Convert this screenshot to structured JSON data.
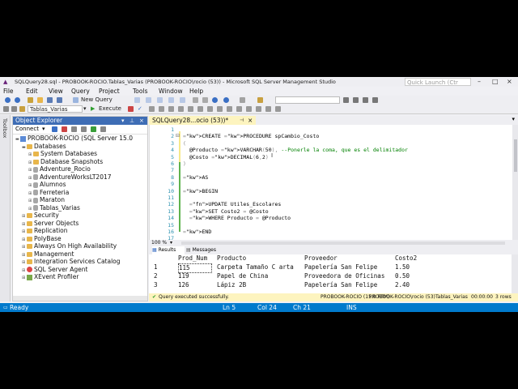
{
  "window": {
    "title": "SQLQuery28.sql - PROBOOK-ROCIO.Tablas_Varias (PROBOOK-ROCIO\\rocio (53)) - Microsoft SQL Server Management Studio",
    "quick_launch_placeholder": "Quick Launch (Ctr"
  },
  "menu": [
    "File",
    "Edit",
    "View",
    "Query",
    "Project",
    "Tools",
    "Window",
    "Help"
  ],
  "toolbar": {
    "new_query": "New Query",
    "database": "Tablas_Varias",
    "execute": "Execute"
  },
  "toolbox_label": "Toolbox",
  "object_explorer": {
    "title": "Object Explorer",
    "connect": "Connect",
    "tree": [
      {
        "label": "PROBOOK-ROCIO (SQL Server 15.0",
        "level": 0,
        "icon": "server",
        "exp": "−"
      },
      {
        "label": "Databases",
        "level": 1,
        "icon": "folder",
        "exp": "−"
      },
      {
        "label": "System Databases",
        "level": 2,
        "icon": "folder",
        "exp": "+"
      },
      {
        "label": "Database Snapshots",
        "level": 2,
        "icon": "folder",
        "exp": "+"
      },
      {
        "label": "Adventure_Rocio",
        "level": 2,
        "icon": "db",
        "exp": "+"
      },
      {
        "label": "AdventureWorksLT2017",
        "level": 2,
        "icon": "db",
        "exp": "+"
      },
      {
        "label": "Alumnos",
        "level": 2,
        "icon": "db",
        "exp": "+"
      },
      {
        "label": "Ferreteria",
        "level": 2,
        "icon": "db",
        "exp": "+"
      },
      {
        "label": "Maraton",
        "level": 2,
        "icon": "db",
        "exp": "+"
      },
      {
        "label": "Tablas_Varias",
        "level": 2,
        "icon": "db",
        "exp": "+"
      },
      {
        "label": "Security",
        "level": 1,
        "icon": "folder",
        "exp": "+"
      },
      {
        "label": "Server Objects",
        "level": 1,
        "icon": "folder",
        "exp": "+"
      },
      {
        "label": "Replication",
        "level": 1,
        "icon": "folder",
        "exp": "+"
      },
      {
        "label": "PolyBase",
        "level": 1,
        "icon": "folder",
        "exp": "+"
      },
      {
        "label": "Always On High Availability",
        "level": 1,
        "icon": "folder",
        "exp": "+"
      },
      {
        "label": "Management",
        "level": 1,
        "icon": "folder",
        "exp": "+"
      },
      {
        "label": "Integration Services Catalog",
        "level": 1,
        "icon": "folder",
        "exp": "+"
      },
      {
        "label": "SQL Server Agent",
        "level": 1,
        "icon": "agent",
        "exp": "+"
      },
      {
        "label": "XEvent Profiler",
        "level": 1,
        "icon": "green",
        "exp": "+"
      }
    ]
  },
  "editor": {
    "tab_label": "SQLQuery28...ocio (53))*",
    "lines": [
      {
        "n": "1",
        "text": ""
      },
      {
        "n": "2",
        "text": "CREATE PROCEDURE spCambio_Costo"
      },
      {
        "n": "3",
        "text": "("
      },
      {
        "n": "4",
        "text": "  @Producto VARCHAR(50), --Ponerle la coma, que es el delimitador"
      },
      {
        "n": "5",
        "text": "  @Costo DECIMAL(6,2)"
      },
      {
        "n": "6",
        "text": ")"
      },
      {
        "n": "7",
        "text": ""
      },
      {
        "n": "8",
        "text": "AS"
      },
      {
        "n": "9",
        "text": ""
      },
      {
        "n": "10",
        "text": "BEGIN"
      },
      {
        "n": "11",
        "text": ""
      },
      {
        "n": "12",
        "text": "  UPDATE Utiles_Escolares"
      },
      {
        "n": "13",
        "text": "  SET Costo2 = @Costo"
      },
      {
        "n": "14",
        "text": "  WHERE Producto = @Producto"
      },
      {
        "n": "15",
        "text": ""
      },
      {
        "n": "16",
        "text": "END"
      },
      {
        "n": "17",
        "text": ""
      }
    ],
    "zoom": "100 %"
  },
  "results": {
    "tabs": [
      "Results",
      "Messages"
    ],
    "columns": [
      "Prod_Num",
      "Producto",
      "Proveedor",
      "Costo2"
    ],
    "rows": [
      {
        "idx": "1",
        "cells": [
          "115",
          "Carpeta Tamaño C arta",
          "Papelería San Felipe",
          "1.50"
        ]
      },
      {
        "idx": "2",
        "cells": [
          "119",
          "Papel de China",
          "Proveedora de Oficinas",
          "0.50"
        ]
      },
      {
        "idx": "3",
        "cells": [
          "126",
          "Lápiz 2B",
          "Papelería San Felipe",
          "2.40"
        ]
      }
    ]
  },
  "query_status": {
    "message": "Query executed successfully.",
    "server": "PROBOOK-ROCIO (15.0 RTM)",
    "user": "PROBOOK-ROCIO\\rocio (53)",
    "db": "Tablas_Varias",
    "time": "00:00:00",
    "rows": "3 rows"
  },
  "statusbar": {
    "ready": "Ready",
    "ln": "Ln 5",
    "col": "Col 24",
    "ch": "Ch 21",
    "ins": "INS"
  }
}
